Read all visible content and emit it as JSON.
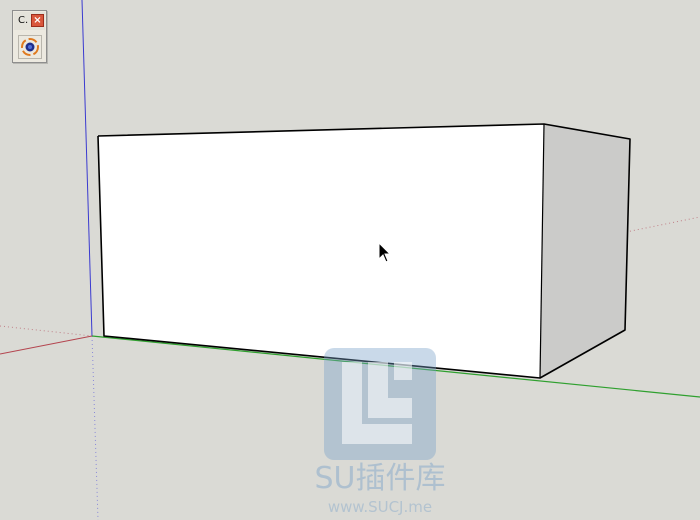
{
  "toolbar": {
    "title": "C.",
    "close_label": "×",
    "tool_icon": "orbit-icon"
  },
  "watermark": {
    "name": "SU插件库",
    "url": "www.SUCJ.me"
  },
  "scene": {
    "colors": {
      "background": "#dadad5",
      "front_face": "#ffffff",
      "side_face": "#cbcbc9",
      "edge": "#000000",
      "red_axis": "#b4454f",
      "green_axis": "#2fa02f",
      "blue_axis": "#3a3ad0"
    }
  },
  "cursor": {
    "icon": "arrow-cursor-icon"
  }
}
